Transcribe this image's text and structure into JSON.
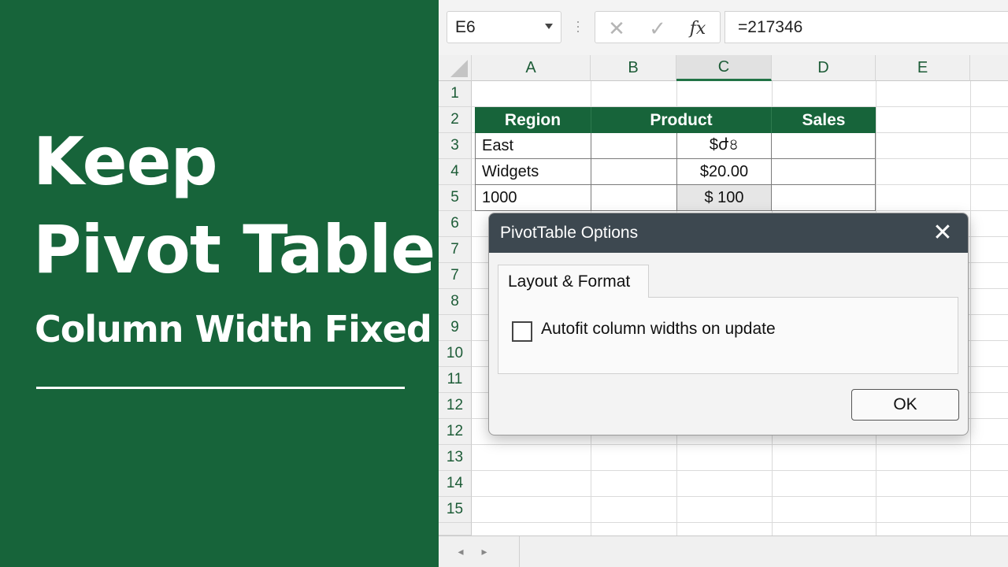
{
  "promo": {
    "line1": "Keep",
    "line2": "Pivot Table",
    "subtitle": "Column Width Fixed"
  },
  "formula_bar": {
    "name_box": "E6",
    "cancel_icon": "✕",
    "enter_icon": "✓",
    "fx_label": "fx",
    "formula": "=217346"
  },
  "sheet": {
    "columns": [
      {
        "label": "A",
        "selected": false
      },
      {
        "label": "B",
        "selected": false
      },
      {
        "label": "C",
        "selected": true
      },
      {
        "label": "D",
        "selected": false
      },
      {
        "label": "E",
        "selected": false
      }
    ],
    "rows": [
      "1",
      "2",
      "3",
      "4",
      "5",
      "6",
      "7",
      "7",
      "8",
      "9",
      "10",
      "11",
      "12",
      "12",
      "13",
      "14",
      "15"
    ],
    "table": {
      "headers": [
        "Region",
        "Product",
        "Sales"
      ],
      "r3": {
        "a": "East",
        "c": "$ժ৪"
      },
      "r4": {
        "a": "Widgets",
        "c": "$20.00"
      },
      "r5": {
        "a": "1000",
        "c": "$ 100"
      }
    }
  },
  "sheet_nav": {
    "prev": "◂",
    "next": "▸"
  },
  "dialog": {
    "title": "PivotTable Options",
    "close": "✕",
    "tab": "Layout & Format",
    "checkbox_label": "Autofit column widths on update",
    "checkbox_checked": false,
    "ok_label": "OK"
  },
  "colors": {
    "brand_green": "#17643a",
    "excel_green": "#217346",
    "dialog_title_bg": "#3d4850"
  }
}
